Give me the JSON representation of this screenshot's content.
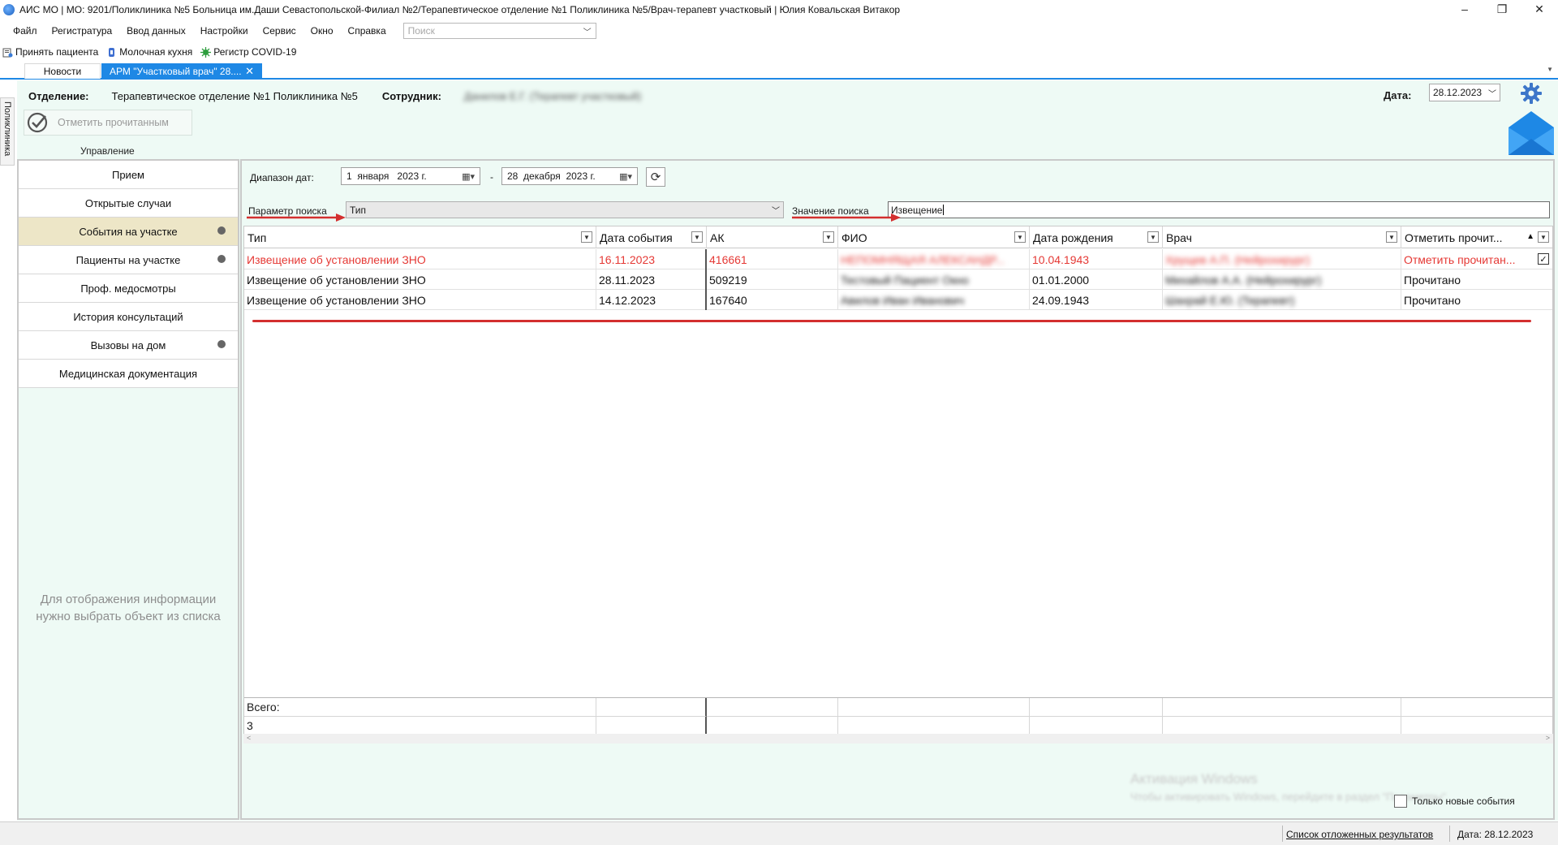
{
  "window": {
    "title": "АИС МО | МО: 9201/Поликлиника №5 Больница им.Даши Севастопольской-Филиал №2/Терапевтическое отделение №1 Поликлиника №5/Врач-терапевт участковый | Юлия Ковальская Витакор",
    "minimize": "–",
    "restore": "❐",
    "close": "✕"
  },
  "menu": {
    "items": [
      "Файл",
      "Регистратура",
      "Ввод данных",
      "Настройки",
      "Сервис",
      "Окно",
      "Справка"
    ],
    "search_placeholder": "Поиск"
  },
  "quickbar": {
    "items": [
      {
        "label": "Принять пациента",
        "icon": "accept-patient-icon"
      },
      {
        "label": "Молочная кухня",
        "icon": "milk-bottle-icon"
      },
      {
        "label": "Регистр COVID-19",
        "icon": "virus-icon"
      }
    ]
  },
  "doctabs": {
    "news": "Новости",
    "active": "АРМ \"Участковый врач\" 28....",
    "close": "✕"
  },
  "vertical_tab": "Поликлиника",
  "header": {
    "department_label": "Отделение:",
    "department_value": "Терапевтическое отделение №1 Поликлиника №5",
    "employee_label": "Сотрудник:",
    "employee_value": "Данилов Е.Г. (Терапевт участковый)",
    "date_label": "Дата:",
    "date_value": "28.12.2023"
  },
  "toolbar": {
    "mark_read_label": "Отметить прочитанным",
    "group_label": "Управление"
  },
  "leftnav": {
    "items": [
      {
        "label": "Прием",
        "dot": false
      },
      {
        "label": "Открытые случаи",
        "dot": false
      },
      {
        "label": "События на участке",
        "dot": true,
        "active": true
      },
      {
        "label": "Пациенты на участке",
        "dot": true
      },
      {
        "label": "Проф. медосмотры",
        "dot": false
      },
      {
        "label": "История консультаций",
        "dot": false
      },
      {
        "label": "Вызовы на дом",
        "dot": true
      },
      {
        "label": "Медицинская документация",
        "dot": false
      }
    ],
    "empty_line1": "Для отображения информации",
    "empty_line2": "нужно выбрать объект из списка"
  },
  "filters": {
    "range_label": "Диапазон дат:",
    "date_from": "1  января   2023 г.",
    "date_to": "28  декабря  2023 г.",
    "dash": "-",
    "param_label": "Параметр поиска",
    "param_value": "Тип",
    "value_label": "Значение поиска",
    "value_text": "Извещение"
  },
  "grid": {
    "columns": [
      "Тип",
      "Дата события",
      "АК",
      "ФИО",
      "Дата рождения",
      "Врач",
      "Отметить прочит..."
    ],
    "rows": [
      {
        "type": "Извещение об установлении ЗНО",
        "date": "16.11.2023",
        "ak": "416661",
        "fio": "НЕПОМНЯЩАЯ АЛЕКСАНДР...",
        "birth": "10.04.1943",
        "doctor": "Хрущев А.П. (Нейрохирург)",
        "status": "Отметить прочитан...",
        "unread": true
      },
      {
        "type": "Извещение об установлении ЗНО",
        "date": "28.11.2023",
        "ak": "509219",
        "fio": "Тестовый Пациент Окно",
        "birth": "01.01.2000",
        "doctor": "Михайлов А.А. (Нейрохирург)",
        "status": "Прочитано",
        "unread": false
      },
      {
        "type": "Извещение об установлении ЗНО",
        "date": "14.12.2023",
        "ak": "167640",
        "fio": "Авилов Иван Иванович",
        "birth": "24.09.1943",
        "doctor": "Шахрай Е.Ю. (Терапевт)",
        "status": "Прочитано",
        "unread": false
      }
    ],
    "total_label": "Всего:",
    "total_value": "3"
  },
  "bottom": {
    "only_new_label": "Только новые события",
    "watermark_line1": "Активация Windows",
    "watermark_line2": "Чтобы активировать Windows, перейдите в раздел \"Параметры\"."
  },
  "status": {
    "deferred_link": "Список отложенных результатов",
    "date": "Дата: 28.12.2023"
  },
  "colors": {
    "accent": "#1e88e5",
    "workspace_bg": "#eefaf5",
    "unread_text": "#e53935",
    "active_nav": "#ede6c7"
  }
}
